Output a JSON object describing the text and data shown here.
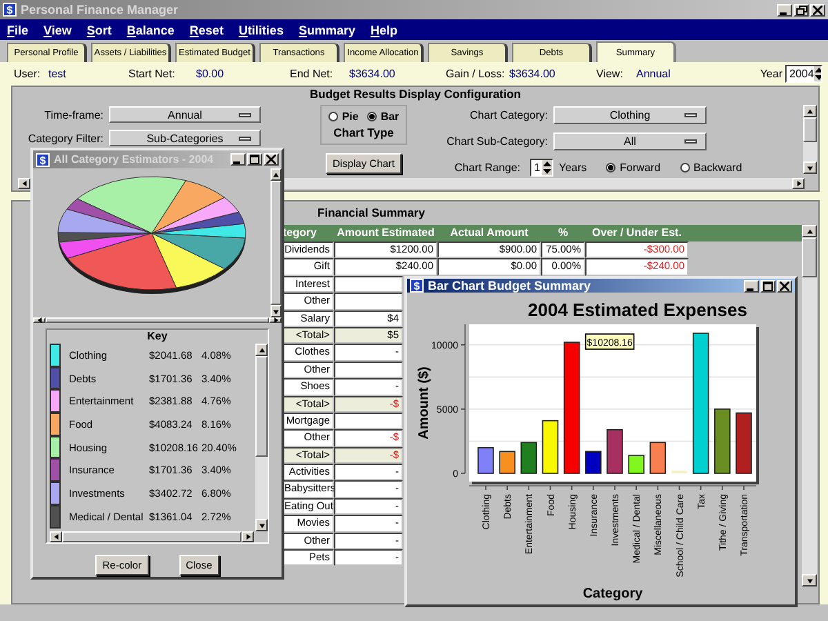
{
  "window": {
    "icon": "$",
    "title": "Personal Finance Manager",
    "active": false
  },
  "menu": [
    "File",
    "View",
    "Sort",
    "Balance",
    "Reset",
    "Utilities",
    "Summary",
    "Help"
  ],
  "tabs": [
    {
      "label": "Personal Profile",
      "selected": false
    },
    {
      "label": "Assets / Liabilities",
      "selected": false
    },
    {
      "label": "Estimated Budget",
      "selected": false
    },
    {
      "label": "Transactions",
      "selected": false
    },
    {
      "label": "Income Allocation",
      "selected": false
    },
    {
      "label": "Savings",
      "selected": false
    },
    {
      "label": "Debts",
      "selected": false
    },
    {
      "label": "Summary",
      "selected": true
    }
  ],
  "info": {
    "fields": [
      {
        "label": "User:",
        "value": "test"
      },
      {
        "label": "Start Net:",
        "value": "$0.00"
      },
      {
        "label": "End Net:",
        "value": "$3634.00"
      },
      {
        "label": "Gain / Loss:",
        "value": "$3634.00"
      },
      {
        "label": "View:",
        "value": "Annual"
      }
    ],
    "year": {
      "label": "Year",
      "value": "2004"
    }
  },
  "config": {
    "title": "Budget Results Display Configuration",
    "timeframe": {
      "label": "Time-frame:",
      "value": "Annual"
    },
    "category_filter": {
      "label": "Category Filter:",
      "value": "Sub-Categories"
    },
    "chart_type": {
      "label": "Chart Type",
      "options": [
        {
          "label": "Pie",
          "selected": false
        },
        {
          "label": "Bar",
          "selected": true
        }
      ]
    },
    "display_button": "Display Chart",
    "chart_category": {
      "label": "Chart Category:",
      "value": "Clothing"
    },
    "chart_subcategory": {
      "label": "Chart Sub-Category:",
      "value": "All"
    },
    "chart_range": {
      "label": "Chart Range:",
      "value": "1",
      "unit": "Years",
      "directions": [
        {
          "label": "Forward",
          "selected": true
        },
        {
          "label": "Backward",
          "selected": false
        }
      ]
    }
  },
  "financial_summary": {
    "title": "Financial Summary",
    "columns": [
      "tegory",
      "Amount Estimated",
      "Actual Amount",
      "%",
      "Over / Under Est."
    ],
    "rows": [
      {
        "category": "Dividends",
        "estimated": "$1200.00",
        "actual": "$900.00",
        "percent": "75.00%",
        "over_under": "-$300.00",
        "negative": true,
        "total": false
      },
      {
        "category": "Gift",
        "estimated": "$240.00",
        "actual": "$0.00",
        "percent": "0.00%",
        "over_under": "-$240.00",
        "negative": true,
        "total": false
      },
      {
        "category": "Interest",
        "total": false
      },
      {
        "category": "Other",
        "total": false
      },
      {
        "category": "Salary",
        "estimated": "$4",
        "negative": false,
        "total": false
      },
      {
        "category": "<Total>",
        "estimated": "$5",
        "negative": false,
        "total": true
      },
      {
        "category": "Clothes",
        "estimated": "-",
        "negative": false,
        "total": false
      },
      {
        "category": "Other",
        "total": false
      },
      {
        "category": "Shoes",
        "estimated": "-",
        "negative": false,
        "total": false
      },
      {
        "category": "<Total>",
        "estimated": "-$",
        "negative": true,
        "total": true
      },
      {
        "category": "Mortgage",
        "total": false
      },
      {
        "category": "Other",
        "estimated": "-$",
        "negative": true,
        "total": false
      },
      {
        "category": "<Total>",
        "estimated": "-$",
        "negative": true,
        "total": true
      },
      {
        "category": "Activities",
        "estimated": "-",
        "negative": false,
        "total": false
      },
      {
        "category": "Babysitters",
        "estimated": "-",
        "negative": false,
        "total": false
      },
      {
        "category": "Eating Out",
        "estimated": "-",
        "negative": false,
        "total": false
      },
      {
        "category": "Movies",
        "estimated": "-",
        "negative": false,
        "total": false
      },
      {
        "category": "Other",
        "estimated": "-",
        "negative": false,
        "total": false
      },
      {
        "category": "Pets",
        "estimated": "-",
        "negative": false,
        "total": false
      }
    ]
  },
  "estimators_window": {
    "icon": "$",
    "title": "All Category Estimators - 2004",
    "active": false,
    "key_title": "Key",
    "key": [
      {
        "name": "Clothing",
        "amount": "$2041.68",
        "percent": "4.08%",
        "color": "#40e8e8"
      },
      {
        "name": "Debts",
        "amount": "$1701.36",
        "percent": "3.40%",
        "color": "#5050a8"
      },
      {
        "name": "Entertainment",
        "amount": "$2381.88",
        "percent": "4.76%",
        "color": "#f8a8f8"
      },
      {
        "name": "Food",
        "amount": "$4083.24",
        "percent": "8.16%",
        "color": "#f8a860"
      },
      {
        "name": "Housing",
        "amount": "$10208.16",
        "percent": "20.40%",
        "color": "#a8f0a8"
      },
      {
        "name": "Insurance",
        "amount": "$1701.36",
        "percent": "3.40%",
        "color": "#a050a8"
      },
      {
        "name": "Investments",
        "amount": "$3402.72",
        "percent": "6.80%",
        "color": "#a8a8f0"
      },
      {
        "name": "Medical / Dental",
        "amount": "$1361.04",
        "percent": "2.72%",
        "color": "#505050"
      }
    ],
    "buttons": [
      "Re-color",
      "Close"
    ]
  },
  "bar_window": {
    "icon": "$",
    "title": "Bar Chart Budget Summary",
    "active": true,
    "bars": [
      {
        "color": "#8080f8"
      },
      {
        "color": "#f89020"
      },
      {
        "color": "#208020"
      },
      {
        "color": "#f8f800"
      },
      {
        "color": "#f80000"
      },
      {
        "color": "#0000c0"
      },
      {
        "color": "#a83060"
      },
      {
        "color": "#80f820"
      },
      {
        "color": "#f88050"
      },
      {
        "color": "#f8f0c0"
      },
      {
        "color": "#00d0d0"
      },
      {
        "color": "#6b8e23"
      },
      {
        "color": "#b02020"
      }
    ],
    "chart_data": {
      "type": "bar",
      "title": "2004 Estimated Expenses",
      "xlabel": "Category",
      "ylabel": "Amount ($)",
      "categories": [
        "Clothing",
        "Debts",
        "Entertainment",
        "Food",
        "Housing",
        "Insurance",
        "Investments",
        "Medical / Dental",
        "Miscellaneous",
        "School / Child Care",
        "Tax",
        "Tithe / Giving",
        "Transportation"
      ],
      "series": [
        {
          "values": [
            2000,
            1700,
            2400,
            4100,
            10200,
            1700,
            3400,
            1400,
            2400,
            200,
            10900,
            5000,
            4700
          ]
        }
      ],
      "ylim": [
        0,
        11600
      ],
      "yticks": [
        0,
        5000,
        10000
      ],
      "annotations": [
        {
          "text": "$10208.16",
          "x": "Housing",
          "y": 10200
        }
      ]
    }
  }
}
